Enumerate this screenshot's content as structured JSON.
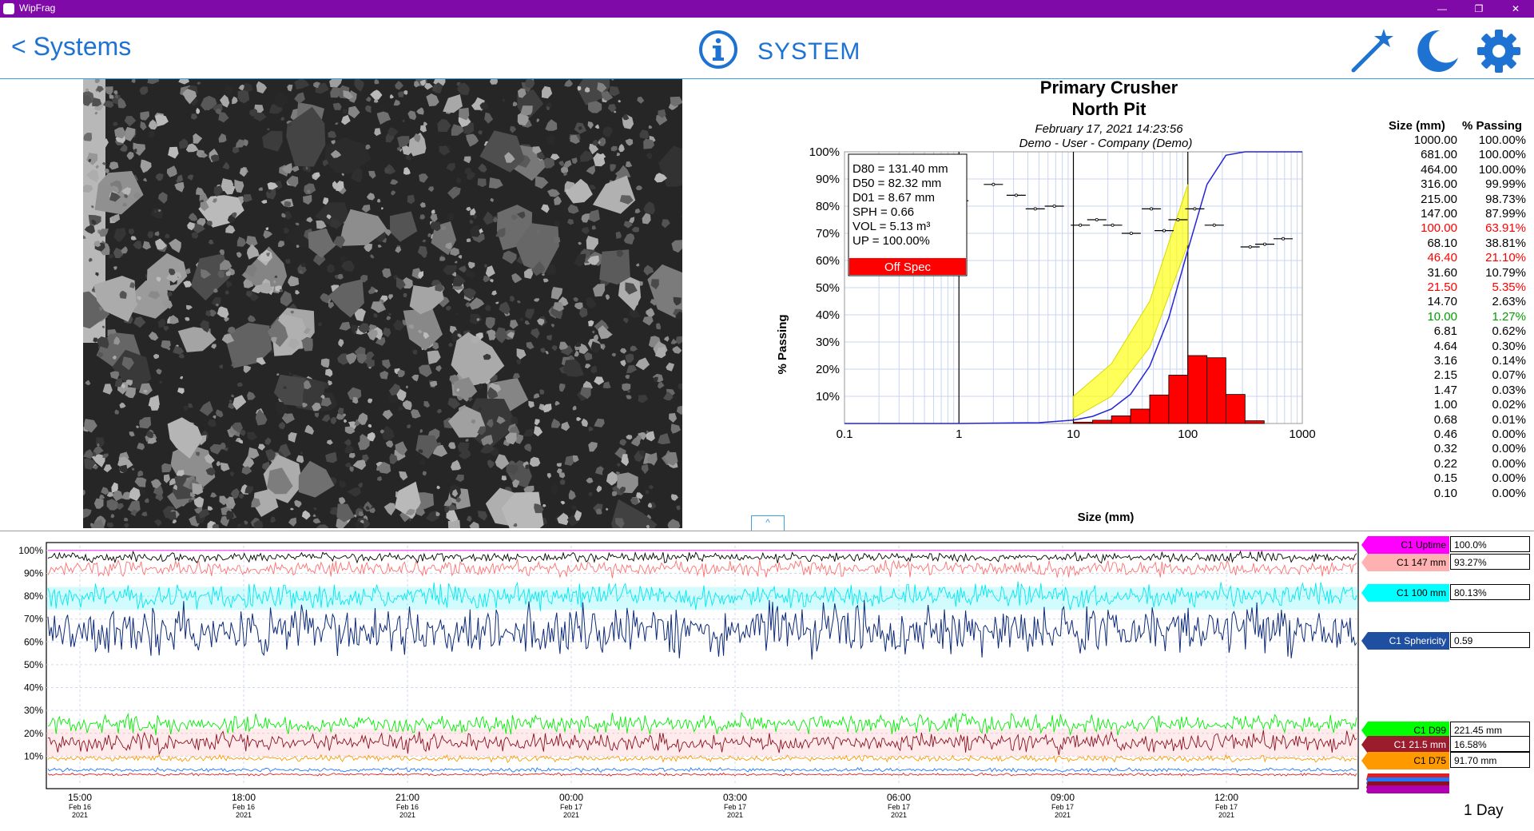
{
  "window": {
    "title": "WipFrag"
  },
  "header": {
    "back_label": "< Systems",
    "title": "SYSTEM"
  },
  "icons": {
    "info": "info-icon",
    "wand": "magic-wand-icon",
    "moon": "dark-mode-icon",
    "gear": "settings-icon",
    "collapse": "chevron-up-icon"
  },
  "colors": {
    "titlebar": "#7f0aa8",
    "accent": "#1e73d2",
    "off_spec": "#ff0000"
  },
  "chart_info": {
    "title": "Primary Crusher",
    "subtitle": "North Pit",
    "timestamp": "February 17, 2021 14:23:56",
    "user_line": "Demo  -  User - Company (Demo)",
    "stats": [
      "D80 = 131.40 mm",
      "D50 = 82.32 mm",
      "D01 = 8.67 mm",
      "SPH = 0.66",
      "VOL = 5.13 m³",
      "UP = 100.00%"
    ],
    "status": "Off Spec"
  },
  "table": {
    "headers": [
      "Size (mm)",
      "% Passing"
    ],
    "rows": [
      {
        "size": "1000.00",
        "pass": "100.00%",
        "color": "#000000"
      },
      {
        "size": "681.00",
        "pass": "100.00%",
        "color": "#000000"
      },
      {
        "size": "464.00",
        "pass": "100.00%",
        "color": "#000000"
      },
      {
        "size": "316.00",
        "pass": "99.99%",
        "color": "#000000"
      },
      {
        "size": "215.00",
        "pass": "98.73%",
        "color": "#000000"
      },
      {
        "size": "147.00",
        "pass": "87.99%",
        "color": "#000000"
      },
      {
        "size": "100.00",
        "pass": "63.91%",
        "color": "#ff0000"
      },
      {
        "size": "68.10",
        "pass": "38.81%",
        "color": "#000000"
      },
      {
        "size": "46.40",
        "pass": "21.10%",
        "color": "#ff0000"
      },
      {
        "size": "31.60",
        "pass": "10.79%",
        "color": "#000000"
      },
      {
        "size": "21.50",
        "pass": "5.35%",
        "color": "#ff0000"
      },
      {
        "size": "14.70",
        "pass": "2.63%",
        "color": "#000000"
      },
      {
        "size": "10.00",
        "pass": "1.27%",
        "color": "#00a000"
      },
      {
        "size": "6.81",
        "pass": "0.62%",
        "color": "#000000"
      },
      {
        "size": "4.64",
        "pass": "0.30%",
        "color": "#000000"
      },
      {
        "size": "3.16",
        "pass": "0.14%",
        "color": "#000000"
      },
      {
        "size": "2.15",
        "pass": "0.07%",
        "color": "#000000"
      },
      {
        "size": "1.47",
        "pass": "0.03%",
        "color": "#000000"
      },
      {
        "size": "1.00",
        "pass": "0.02%",
        "color": "#000000"
      },
      {
        "size": "0.68",
        "pass": "0.01%",
        "color": "#000000"
      },
      {
        "size": "0.46",
        "pass": "0.00%",
        "color": "#000000"
      },
      {
        "size": "0.32",
        "pass": "0.00%",
        "color": "#000000"
      },
      {
        "size": "0.22",
        "pass": "0.00%",
        "color": "#000000"
      },
      {
        "size": "0.15",
        "pass": "0.00%",
        "color": "#000000"
      },
      {
        "size": "0.10",
        "pass": "0.00%",
        "color": "#000000"
      }
    ]
  },
  "trend_legend": [
    {
      "label": "C1 Uptime",
      "value": "100.0%",
      "color": "#ff00ff"
    },
    {
      "label": "C1 147 mm",
      "value": "93.27%",
      "color": "#ffb0b0"
    },
    {
      "label": "C1 100 mm",
      "value": "80.13%",
      "color": "#00ffff"
    },
    {
      "label": "C1 Sphericity",
      "value": "0.59",
      "color": "#1f4fa0"
    },
    {
      "label": "C1 D99",
      "value": "221.45 mm",
      "color": "#00ff00"
    },
    {
      "label": "C1 21.5 mm",
      "value": "16.58%",
      "color": "#9b1c2c"
    },
    {
      "label": "C1 D75",
      "value": "91.70 mm",
      "color": "#ff9900"
    }
  ],
  "trend_range": "1 Day",
  "chart_data": [
    {
      "type": "line",
      "xlabel": "Size (mm)",
      "ylabel": "% Passing",
      "x_scale": "log",
      "xlim": [
        0.1,
        1000
      ],
      "ylim": [
        0,
        100
      ],
      "x_ticks": [
        "0.1",
        "1",
        "10",
        "100",
        "1000"
      ],
      "y_ticks": [
        "10%",
        "20%",
        "30%",
        "40%",
        "50%",
        "60%",
        "70%",
        "80%",
        "90%",
        "100%"
      ],
      "grid": true,
      "series": [],
      "cumulative_curve": {
        "x": [
          0.1,
          1,
          5,
          10,
          14.7,
          21.5,
          31.6,
          46.4,
          68.1,
          100,
          147,
          215,
          316,
          464,
          1000
        ],
        "y": [
          0,
          0,
          0.3,
          1.27,
          2.63,
          5.35,
          10.79,
          21.1,
          38.81,
          63.91,
          87.99,
          98.73,
          99.99,
          100,
          100
        ]
      },
      "spec_band": {
        "x": [
          10,
          21.5,
          46.4,
          100
        ],
        "y_low": [
          2,
          10,
          28,
          66
        ],
        "y_high": [
          10,
          22,
          45,
          88
        ]
      },
      "histogram": {
        "x_edges": [
          10,
          14.7,
          21.5,
          31.6,
          46.4,
          68.1,
          100,
          147,
          215,
          316
        ],
        "values": [
          0.5,
          1.2,
          2.8,
          5.3,
          10.5,
          17.8,
          25,
          24.2,
          10.7,
          1
        ]
      },
      "markers": {
        "x": [
          1,
          2,
          3.16,
          4.64,
          6.81,
          11.5,
          16,
          22,
          32,
          48,
          62,
          82,
          115,
          170,
          350,
          470,
          680
        ],
        "y": [
          82,
          88,
          84,
          79,
          80,
          73,
          75,
          73,
          70,
          79,
          71,
          75,
          79,
          73,
          65,
          66,
          68
        ]
      },
      "vertical_lines": [
        1,
        10,
        100
      ]
    },
    {
      "type": "line",
      "ylim": [
        0,
        100
      ],
      "y_ticks": [
        "10%",
        "20%",
        "30%",
        "40%",
        "50%",
        "60%",
        "70%",
        "80%",
        "90%",
        "100%"
      ],
      "x_ticks": [
        {
          "time": "15:00",
          "date": "Feb 16",
          "year": "2021"
        },
        {
          "time": "18:00",
          "date": "Feb 16",
          "year": "2021"
        },
        {
          "time": "21:00",
          "date": "Feb 16",
          "year": "2021"
        },
        {
          "time": "00:00",
          "date": "Feb 17",
          "year": "2021"
        },
        {
          "time": "03:00",
          "date": "Feb 17",
          "year": "2021"
        },
        {
          "time": "06:00",
          "date": "Feb 17",
          "year": "2021"
        },
        {
          "time": "09:00",
          "date": "Feb 17",
          "year": "2021"
        },
        {
          "time": "12:00",
          "date": "Feb 17",
          "year": "2021"
        }
      ],
      "series": [
        {
          "name": "C1 Uptime",
          "mean": 100,
          "noise": 0,
          "color": "#ff00ff"
        },
        {
          "name": "",
          "mean": 97,
          "noise": 1.5,
          "color": "#000000"
        },
        {
          "name": "C1 147 mm",
          "mean": 92,
          "noise": 2.5,
          "color": "#ff7070"
        },
        {
          "name": "C1 100 mm",
          "mean": 80,
          "noise": 4,
          "color": "#00e8f0"
        },
        {
          "name": "C1 Sphericity",
          "mean": 65,
          "noise": 8,
          "color": "#0d2a7a"
        },
        {
          "name": "C1 D99",
          "mean": 24,
          "noise": 3,
          "color": "#00ee00"
        },
        {
          "name": "C1 21.5 mm",
          "mean": 16,
          "noise": 3,
          "color": "#8a1020"
        },
        {
          "name": "C1 D75",
          "mean": 9,
          "noise": 1,
          "color": "#ff9900"
        },
        {
          "name": "",
          "mean": 4,
          "noise": 0.6,
          "color": "#2277ff"
        },
        {
          "name": "",
          "mean": 2,
          "noise": 0.4,
          "color": "#dd2222"
        }
      ]
    }
  ]
}
